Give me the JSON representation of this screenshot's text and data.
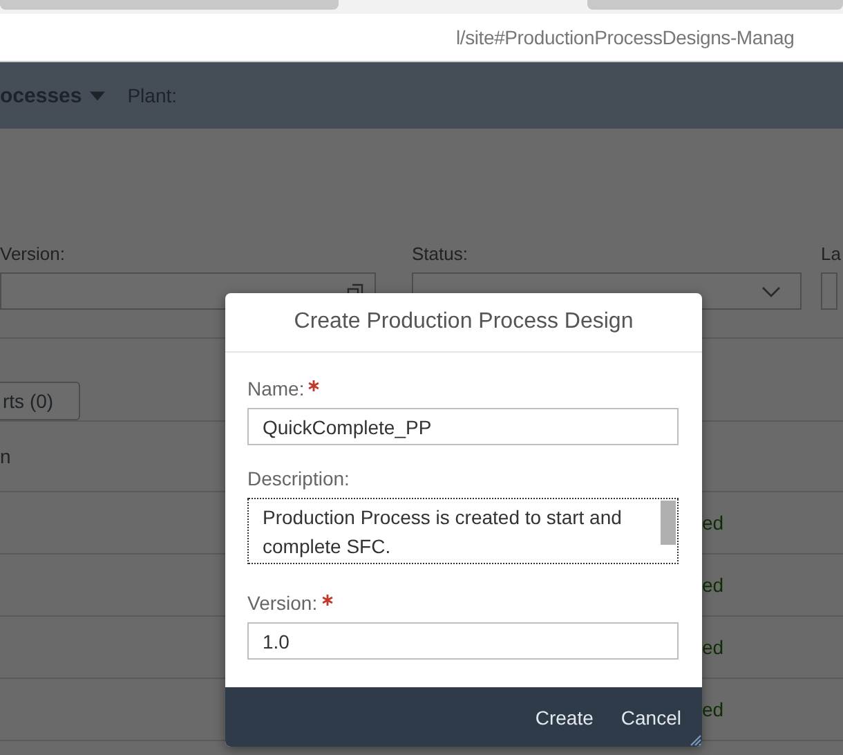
{
  "browser": {
    "url": "l/site#ProductionProcessDesigns-Manag"
  },
  "header": {
    "title": "ocesses",
    "plant_label": "Plant:"
  },
  "filters": [
    {
      "label": "Version:",
      "kind": "input"
    },
    {
      "label": "Status:",
      "kind": "select"
    },
    {
      "label": "La",
      "kind": "input"
    }
  ],
  "toolbar": {
    "button": "rts (0)"
  },
  "table": {
    "column_1": "n",
    "rows": [
      {
        "status": "ed"
      },
      {
        "status": "ed"
      },
      {
        "status": "ed"
      },
      {
        "status": "ed"
      }
    ]
  },
  "dialog": {
    "title": "Create Production Process Design",
    "fields": [
      {
        "label": "Name:",
        "required": true,
        "kind": "input",
        "value": "QuickComplete_PP"
      },
      {
        "label": "Description:",
        "required": false,
        "kind": "textarea",
        "value": "Production Process is created to start and complete SFC."
      },
      {
        "label": "Version:",
        "required": true,
        "kind": "input",
        "value": "1.0"
      }
    ],
    "buttons": [
      "Create",
      "Cancel"
    ]
  }
}
